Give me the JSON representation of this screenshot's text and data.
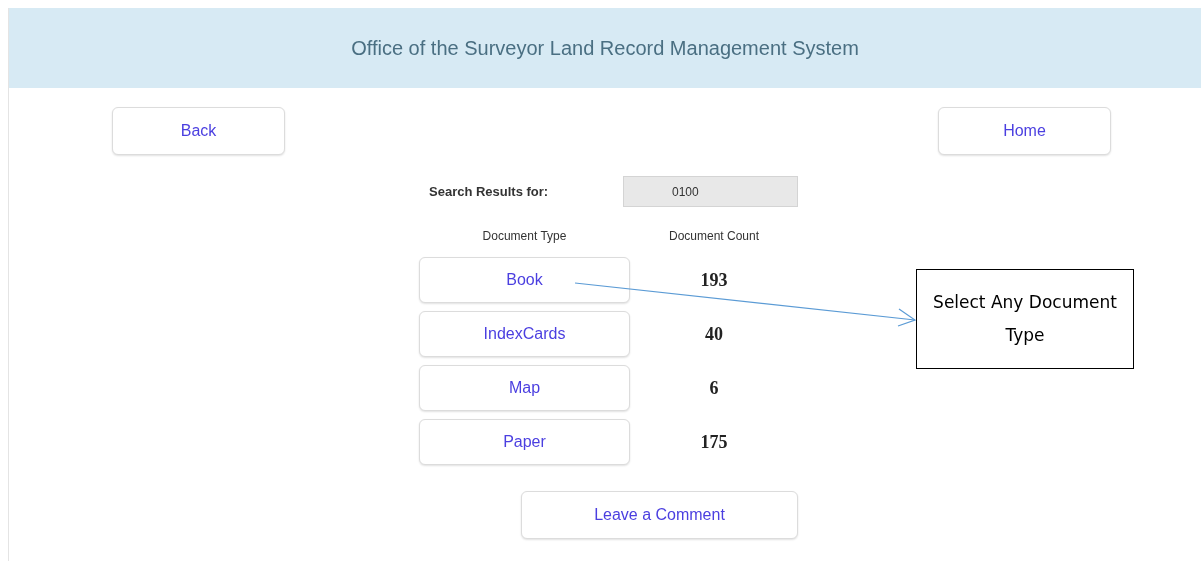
{
  "header": {
    "title": "Office of the Surveyor Land Record Management System"
  },
  "nav": {
    "back": "Back",
    "home": "Home"
  },
  "search": {
    "label": "Search Results for:",
    "value": "0100"
  },
  "table": {
    "columns": [
      "Document Type",
      "Document Count"
    ],
    "rows": [
      {
        "type": "Book",
        "count": "193"
      },
      {
        "type": "IndexCards",
        "count": "40"
      },
      {
        "type": "Map",
        "count": "6"
      },
      {
        "type": "Paper",
        "count": "175"
      }
    ]
  },
  "comment_button": "Leave a Comment",
  "callout": {
    "text": "Select Any Document Type"
  }
}
